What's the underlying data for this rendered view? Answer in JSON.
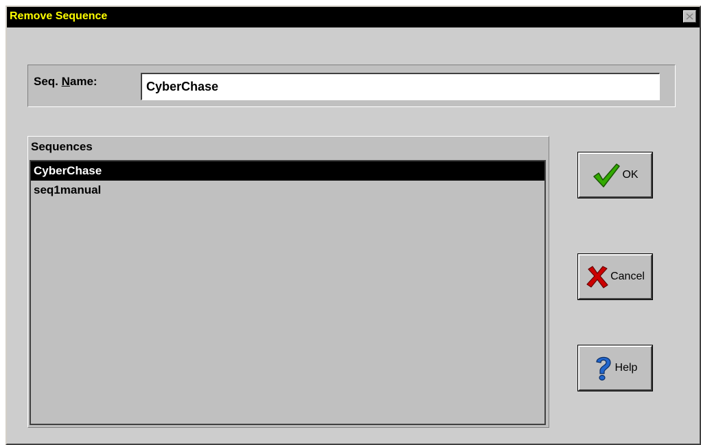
{
  "window": {
    "title": "Remove Sequence"
  },
  "form": {
    "name_label_prefix": "Seq. ",
    "name_label_accel": "N",
    "name_label_suffix": "ame:",
    "name_value": "CyberChase"
  },
  "sequences": {
    "header": "Sequences",
    "items": [
      {
        "label": "CyberChase",
        "selected": true
      },
      {
        "label": "seq1manual",
        "selected": false
      }
    ]
  },
  "buttons": {
    "ok_label": "OK",
    "cancel_label": "Cancel",
    "help_label": "Help"
  },
  "icons": {
    "close": "close-icon",
    "ok": "checkmark-icon",
    "cancel": "red-x-icon",
    "help": "question-mark-icon"
  },
  "colors": {
    "title_bg": "#000000",
    "title_text": "#ffff00",
    "selection_bg": "#000000",
    "checkmark": "#33aa00",
    "cancel_x": "#cc0000",
    "help_q": "#2266cc"
  }
}
